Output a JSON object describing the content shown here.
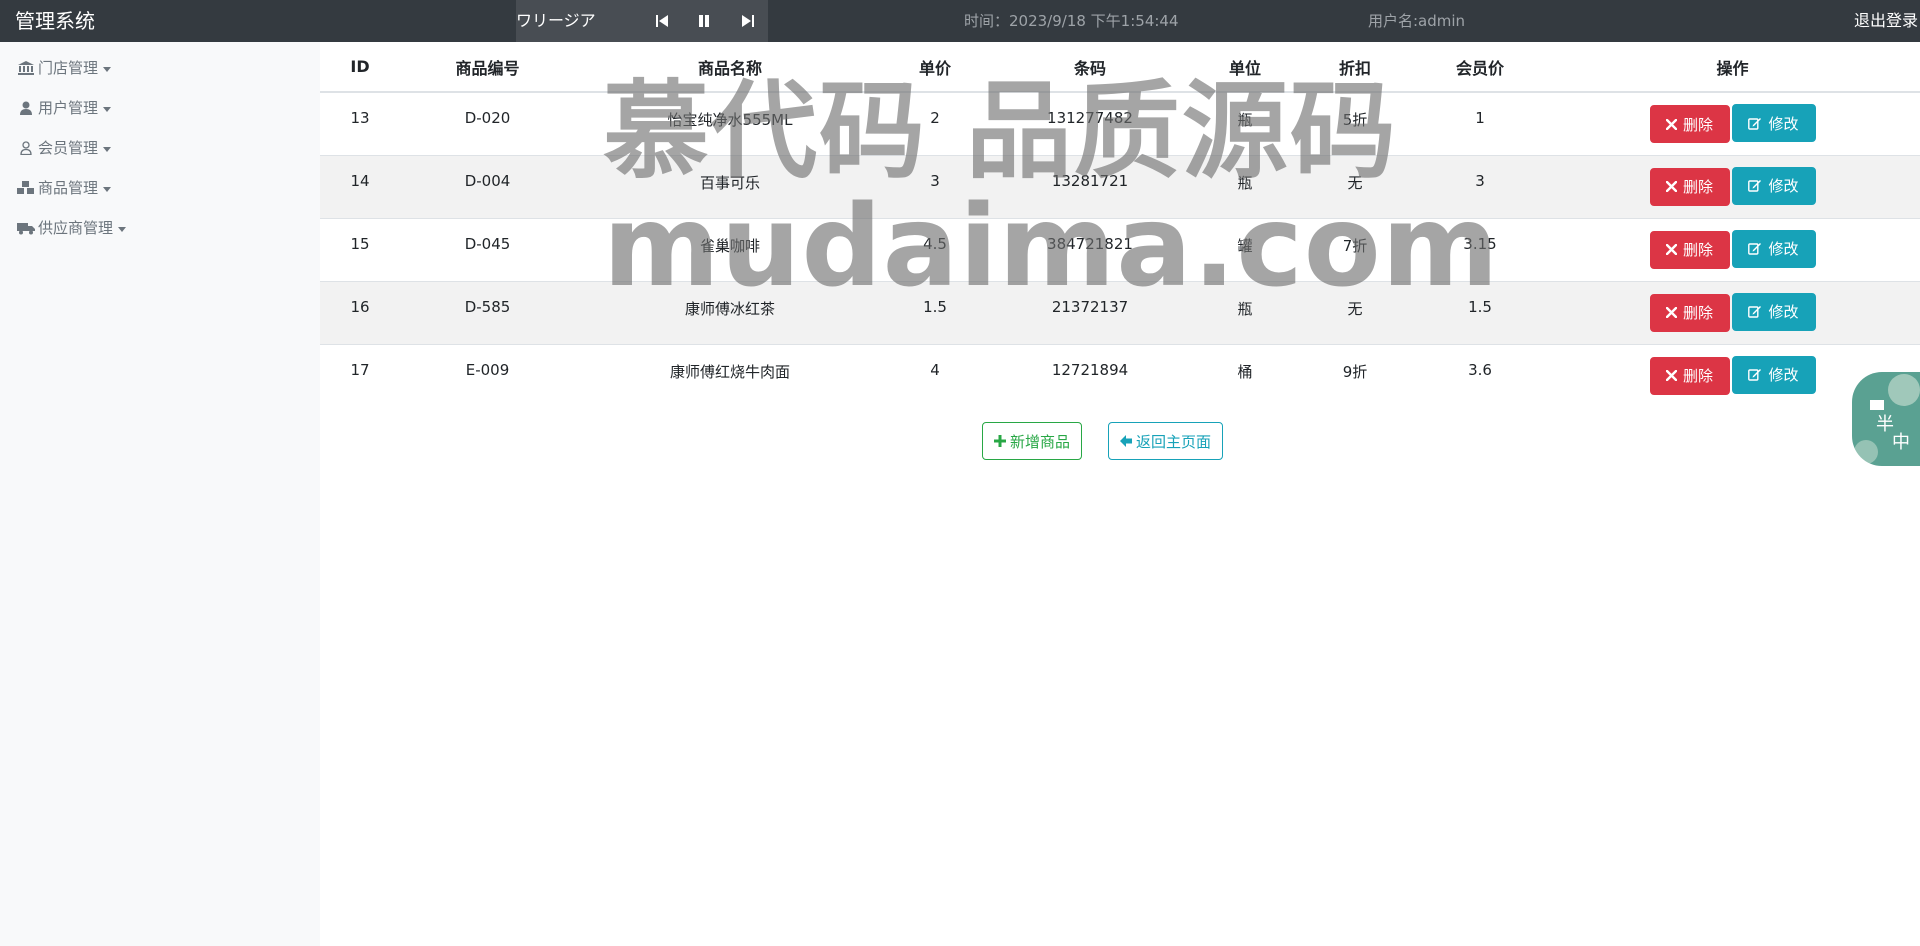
{
  "header": {
    "brand": "管理系统",
    "player_title": "ワリージア",
    "time_text": "时间：2023/9/18 下午1:54:44",
    "user_text": "用户名:admin",
    "logout_label": "退出登录"
  },
  "sidebar": {
    "items": [
      {
        "label": "门店管理",
        "icon": "bank-icon"
      },
      {
        "label": "用户管理",
        "icon": "user-icon"
      },
      {
        "label": "会员管理",
        "icon": "user-outline-icon"
      },
      {
        "label": "商品管理",
        "icon": "cubes-icon"
      },
      {
        "label": "供应商管理",
        "icon": "truck-icon"
      }
    ]
  },
  "table": {
    "headers": [
      "ID",
      "商品编号",
      "商品名称",
      "单价",
      "条码",
      "单位",
      "折扣",
      "会员价",
      "操作"
    ],
    "rows": [
      [
        "13",
        "D-020",
        "怡宝纯净水555ML",
        "2",
        "131277482",
        "瓶",
        "5折",
        "1"
      ],
      [
        "14",
        "D-004",
        "百事可乐",
        "3",
        "13281721",
        "瓶",
        "无",
        "3"
      ],
      [
        "15",
        "D-045",
        "雀巢咖啡",
        "4.5",
        "384721821",
        "罐",
        "7折",
        "3.15"
      ],
      [
        "16",
        "D-585",
        "康师傅冰红茶",
        "1.5",
        "21372137",
        "瓶",
        "无",
        "1.5"
      ],
      [
        "17",
        "E-009",
        "康师傅红烧牛肉面",
        "4",
        "12721894",
        "桶",
        "9折",
        "3.6"
      ]
    ],
    "delete_label": "删除",
    "edit_label": "修改"
  },
  "actions": {
    "add_label": "新增商品",
    "back_label": "返回主页面"
  },
  "watermark": {
    "line1": "慕代码 品质源码",
    "line2": "mudaima.com"
  },
  "mascot": {
    "char1": "半",
    "char2": "中"
  },
  "colors": {
    "topbar": "#343a40",
    "danger": "#dc3545",
    "info": "#17a2b8",
    "success": "#28a745",
    "sidebar_bg": "#f8f9fa"
  }
}
